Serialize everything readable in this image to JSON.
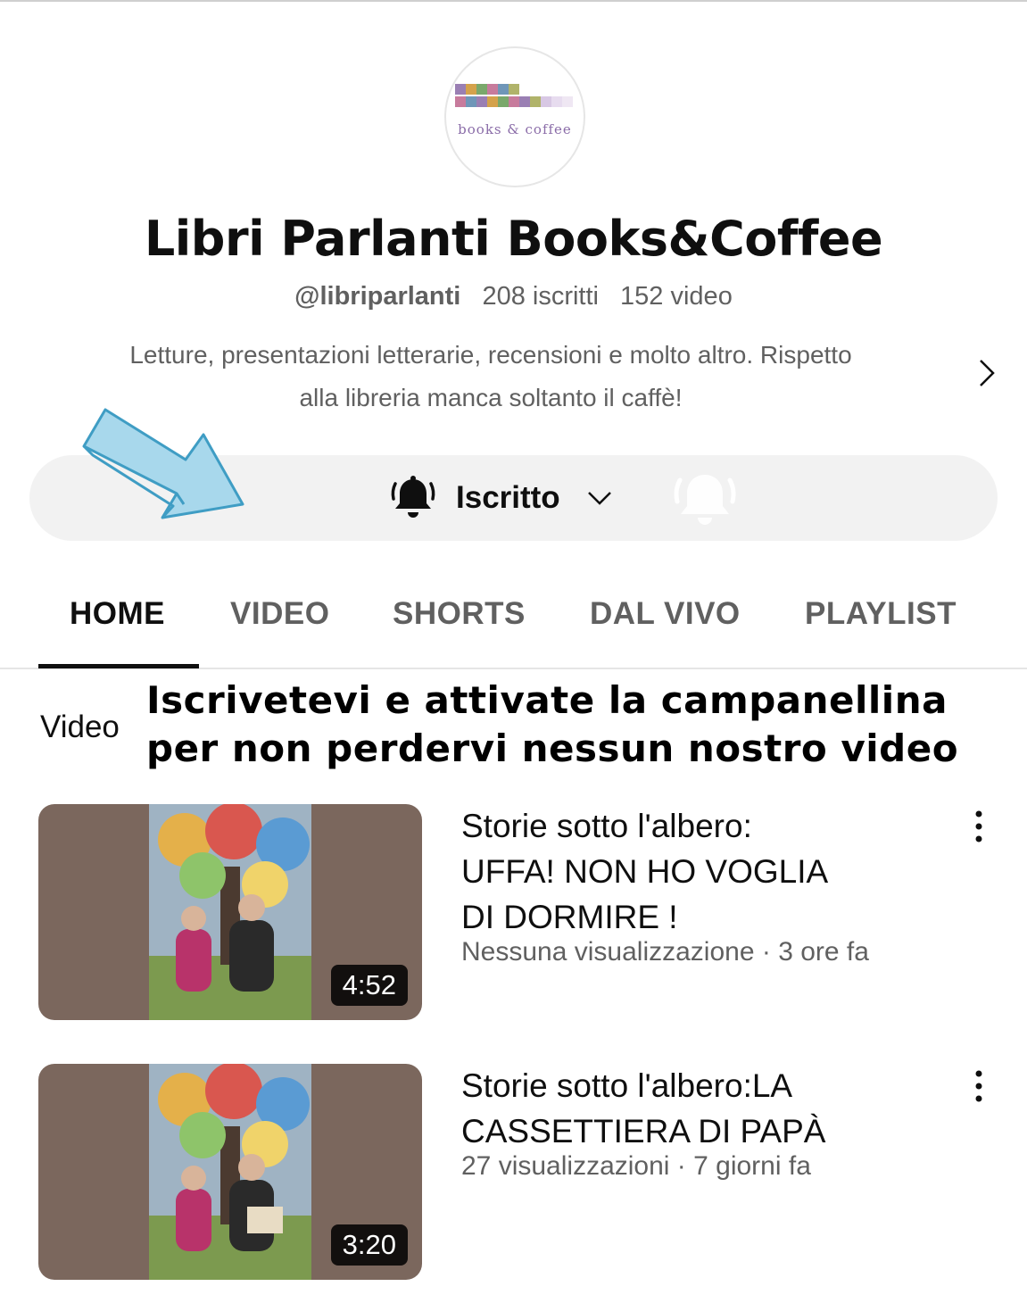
{
  "channel": {
    "logo_text": "libri parlanti",
    "logo_subtext": "books & coffee",
    "name": "Libri Parlanti Books&Coffee",
    "handle": "@libriparlanti",
    "subscribers": "208 iscritti",
    "video_count": "152 video",
    "description_line1": "Letture, presentazioni letterarie, recensioni e molto altro. Rispetto",
    "description_line2": "alla libreria manca soltanto il caffè!",
    "more_icon": "chevron-right-icon"
  },
  "subscribe": {
    "label": "Iscritto",
    "bell_icon": "bell-ringing-icon",
    "dropdown_icon": "chevron-down-icon"
  },
  "tabs": [
    {
      "label": "HOME",
      "active": true
    },
    {
      "label": "VIDEO",
      "active": false
    },
    {
      "label": "SHORTS",
      "active": false
    },
    {
      "label": "DAL VIVO",
      "active": false
    },
    {
      "label": "PLAYLIST",
      "active": false
    }
  ],
  "section": {
    "label": "Video",
    "annotation_line1": "Iscrivetevi e attivate la campanellina",
    "annotation_line2": "per non perdervi nessun nostro video"
  },
  "videos": [
    {
      "title_lines": [
        "Storie sotto l'albero:",
        "UFFA! NON HO VOGLIA",
        "DI DORMIRE !"
      ],
      "views": "Nessuna visualizzazione",
      "age": "3 ore fa",
      "duration": "4:52"
    },
    {
      "title_lines": [
        "Storie sotto l'albero:LA",
        "CASSETTIERA DI PAPÀ"
      ],
      "views": "27 visualizzazioni",
      "age": "7 giorni fa",
      "duration": "3:20"
    }
  ],
  "colors": {
    "text_primary": "#0f0f0f",
    "text_secondary": "#606060",
    "pill_background": "#f2f2f2",
    "annotation_arrow": "#a8d8ec"
  }
}
